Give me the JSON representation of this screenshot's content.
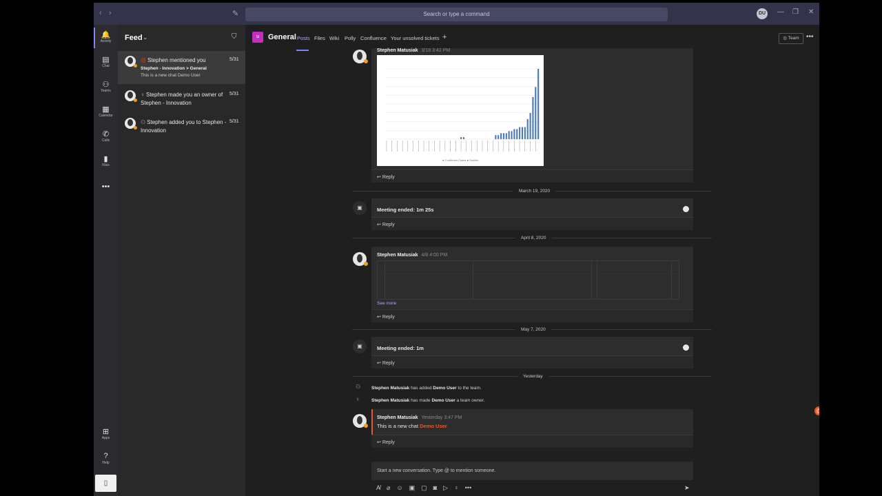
{
  "titlebar": {
    "search_placeholder": "Search or type a command",
    "user_initials": "DU",
    "back": "‹",
    "forward": "›"
  },
  "rail": {
    "items": [
      {
        "label": "Activity",
        "icon": "bell-icon",
        "glyph": "🔔"
      },
      {
        "label": "Chat",
        "icon": "chat-icon",
        "glyph": "▤"
      },
      {
        "label": "Teams",
        "icon": "teams-icon",
        "glyph": "⚇"
      },
      {
        "label": "Calendar",
        "icon": "calendar-icon",
        "glyph": "▦"
      },
      {
        "label": "Calls",
        "icon": "phone-icon",
        "glyph": "✆"
      },
      {
        "label": "Files",
        "icon": "file-icon",
        "glyph": "▮"
      }
    ],
    "more": "•••",
    "bottom": [
      {
        "label": "Apps",
        "icon": "apps-icon",
        "glyph": "⊞"
      },
      {
        "label": "Help",
        "icon": "help-icon",
        "glyph": "?"
      }
    ]
  },
  "feed": {
    "title": "Feed",
    "items": [
      {
        "title": "Stephen mentioned you",
        "context": "Stephen - Innovation > General",
        "preview": "This is a new chat Demo User",
        "date": "5/31"
      },
      {
        "title": "Stephen made you an owner of Stephen - Innovation",
        "date": "5/31"
      },
      {
        "title": "Stephen added you to Stephen - Innovation",
        "date": "5/31"
      }
    ]
  },
  "channel": {
    "avatar": "SI",
    "name": "General",
    "tabs": [
      "Posts",
      "Files",
      "Wiki",
      "Polly",
      "Confluence",
      "Your unsolved tickets"
    ],
    "add_tab": "+",
    "team_button": "◎ Team",
    "more": "•••"
  },
  "posts": {
    "reply_label": "Reply",
    "chart_post": {
      "author": "Stephen Matusiak",
      "time": "3/18 3:42 PM"
    },
    "chart_legend": "● Confirmed Cases  ● Deaths",
    "chart_data": {
      "type": "bar",
      "series": [
        {
          "values": [
            0,
            0,
            0,
            0,
            0,
            0,
            0,
            0,
            0,
            0,
            0,
            0,
            0,
            0,
            0,
            0,
            0,
            0,
            0,
            0,
            0,
            0,
            0,
            0,
            0,
            0,
            0,
            0,
            1,
            1,
            0,
            0,
            0,
            0,
            0,
            0,
            0,
            0,
            0,
            0,
            0,
            2,
            2,
            3,
            3,
            3,
            4,
            4,
            5,
            5,
            6,
            6,
            6,
            10,
            13,
            21,
            26,
            35
          ]
        }
      ]
    },
    "divider_1": "March 19, 2020",
    "meeting_1": "Meeting ended: 1m 25s",
    "divider_2": "April 8, 2020",
    "table_post": {
      "author": "Stephen Matusiak",
      "time": "4/8 4:00 PM",
      "see_more": "See more"
    },
    "divider_3": "May 7, 2020",
    "meeting_2": "Meeting ended: 1m",
    "divider_4": "Yesterday",
    "system_1": {
      "actor": "Stephen Matusiak",
      "verb": " has added ",
      "target": "Demo User",
      "rest": " to the team."
    },
    "system_2": {
      "actor": "Stephen Matusiak",
      "verb": " has made ",
      "target": "Demo User",
      "rest": " a team owner."
    },
    "last_post": {
      "author": "Stephen Matusiak",
      "time": "Yesterday 3:47 PM",
      "text": "This is a new chat ",
      "mention": "Demo User"
    },
    "composer_placeholder": "Start a new conversation. Type @ to mention someone."
  },
  "colors": {
    "accent": "#7f85f5",
    "mention": "#e35a2a",
    "titlebar": "#33344a"
  }
}
